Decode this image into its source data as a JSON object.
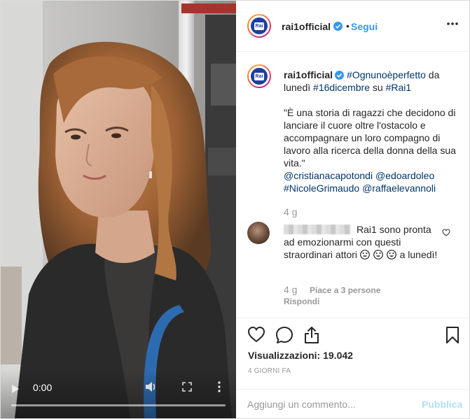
{
  "media": {
    "time": "0:00",
    "play_icon": "play-icon",
    "volume_icon": "volume-icon",
    "fullscreen_icon": "fullscreen-icon",
    "more_icon": "more-vertical-icon"
  },
  "header": {
    "username": "rai1official",
    "dot": "•",
    "follow_label": "Segui",
    "verified_icon": "verified-badge-icon",
    "more_icon": "more-horizontal-icon"
  },
  "caption": {
    "username": "rai1official",
    "hashtag1": "#Ognunoèperfetto",
    "text1": " da lunedì ",
    "hashtag2": "#16dicembre",
    "text2": " su ",
    "hashtag3": "#Rai1",
    "quote": "\"È una storia di ragazzi che decidono di lanciare il cuore oltre l'ostacolo e accompagnare un loro compagno di lavoro alla ricerca della donna della sua vita.\"",
    "mention1": "@cristianacapotondi",
    "mention2": "@edoardoleo",
    "mention3": "#NicoleGrimaudo",
    "mention4": "@raffaelevannoli",
    "time": "4 g"
  },
  "comment": {
    "text": "Rai1 sono pronta ad emozionarmi con questi straordinari attori",
    "after_emoji": "a lunedì!",
    "emoji_icon": "heart-eyes-emoji-icon",
    "time": "4 g",
    "likes": "Piace a 3 persone",
    "reply_label": "Rispondi"
  },
  "actions": {
    "like_icon": "heart-icon",
    "comment_icon": "comment-icon",
    "share_icon": "share-icon",
    "save_icon": "bookmark-icon",
    "views_label": "Visualizzazioni:",
    "views_value": "19.042",
    "date": "4 GIORNI FA"
  },
  "add_comment": {
    "placeholder": "Aggiungi un commento...",
    "publish_label": "Pubblica"
  },
  "colors": {
    "link_blue": "#3897f0",
    "hashtag": "#003569",
    "muted": "#999999",
    "publish_disabled": "#b2dffc"
  }
}
